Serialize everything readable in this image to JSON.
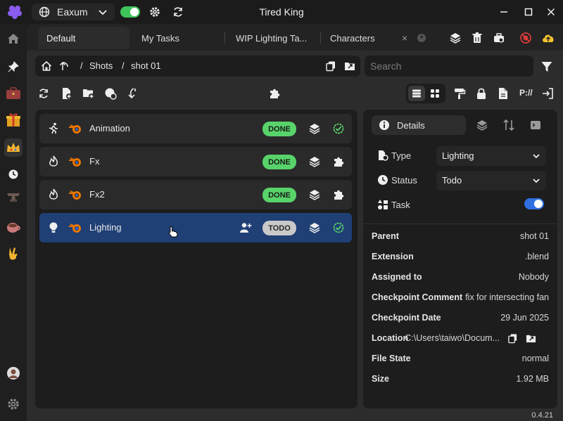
{
  "window": {
    "title": "Tired King",
    "workspace": "Eaxum"
  },
  "tabs": [
    {
      "label": "Default",
      "active": true
    },
    {
      "label": "My Tasks",
      "active": false
    },
    {
      "label": "WIP Lighting Ta...",
      "active": false
    },
    {
      "label": "Characters",
      "active": false
    }
  ],
  "breadcrumb": {
    "items": [
      "Shots",
      "shot 01"
    ]
  },
  "search": {
    "placeholder": "Search",
    "value": ""
  },
  "toolbar": {
    "path_label": "P://"
  },
  "tasks": [
    {
      "name": "Animation",
      "icon": "running-figure-icon",
      "status": "DONE",
      "selected": false,
      "extra_icon": "check-badge-icon"
    },
    {
      "name": "Fx",
      "icon": "flame-icon",
      "status": "DONE",
      "selected": false,
      "extra_icon": "puzzle-icon"
    },
    {
      "name": "Fx2",
      "icon": "flame-icon",
      "status": "DONE",
      "selected": false,
      "extra_icon": "puzzle-icon"
    },
    {
      "name": "Lighting",
      "icon": "lightbulb-icon",
      "status": "TODO",
      "selected": true,
      "extra_icon": "check-badge-icon"
    }
  ],
  "details": {
    "tab_label": "Details",
    "type_label": "Type",
    "type_value": "Lighting",
    "status_label": "Status",
    "status_value": "Todo",
    "task_label": "Task",
    "task_toggle_on": true,
    "info": [
      {
        "key": "Parent",
        "value": "shot 01"
      },
      {
        "key": "Extension",
        "value": ".blend"
      },
      {
        "key": "Assigned to",
        "value": "Nobody"
      },
      {
        "key": "Checkpoint Comment",
        "value": "fix for intersecting fan"
      },
      {
        "key": "Checkpoint Date",
        "value": "29 Jun 2025"
      },
      {
        "key": "Location",
        "value": "C:\\Users\\taiwo\\Docum..."
      },
      {
        "key": "File State",
        "value": "normal"
      },
      {
        "key": "Size",
        "value": "1.92 MB"
      }
    ]
  },
  "version": "0.4.21",
  "colors": {
    "accent_blue": "#2f6fe0",
    "selected_row": "#1f3f75",
    "done_green": "#58d36a",
    "toggle_green": "#3fc45a"
  }
}
